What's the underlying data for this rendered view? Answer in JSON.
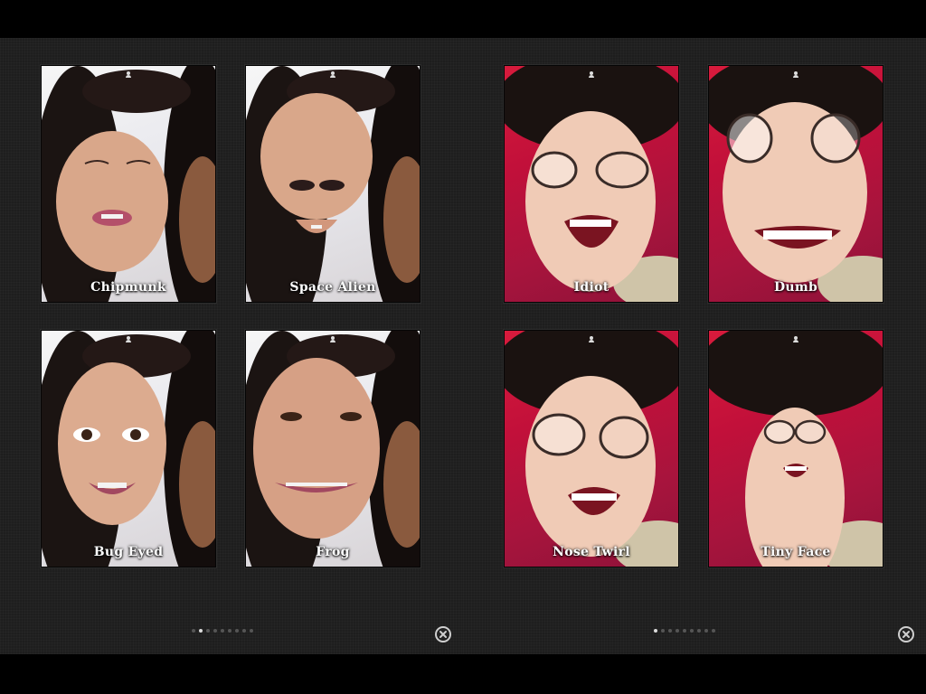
{
  "pages": [
    {
      "id": "left",
      "effects": [
        {
          "label": "Chipmunk",
          "scheme": "light",
          "variant": "chipmunk"
        },
        {
          "label": "Space Alien",
          "scheme": "light",
          "variant": "alien"
        },
        {
          "label": "Bug Eyed",
          "scheme": "light",
          "variant": "bugeyed"
        },
        {
          "label": "Frog",
          "scheme": "light",
          "variant": "frog"
        }
      ],
      "pagination": {
        "count": 9,
        "active": 1
      },
      "close_icon": "close-x-circle-icon"
    },
    {
      "id": "right",
      "effects": [
        {
          "label": "Idiot",
          "scheme": "red",
          "variant": "idiot"
        },
        {
          "label": "Dumb",
          "scheme": "red",
          "variant": "dumb"
        },
        {
          "label": "Nose Twirl",
          "scheme": "red",
          "variant": "nosetwirl"
        },
        {
          "label": "Tiny Face",
          "scheme": "red",
          "variant": "tinyface"
        }
      ],
      "pagination": {
        "count": 9,
        "active": 0
      },
      "close_icon": "close-x-circle-icon"
    }
  ],
  "colors": {
    "panel_bg": "#1e1e1e",
    "label_text": "#ffffff",
    "dot_active": "#dddddd",
    "dot_inactive": "#555555",
    "photo_red": "#c2103a"
  }
}
